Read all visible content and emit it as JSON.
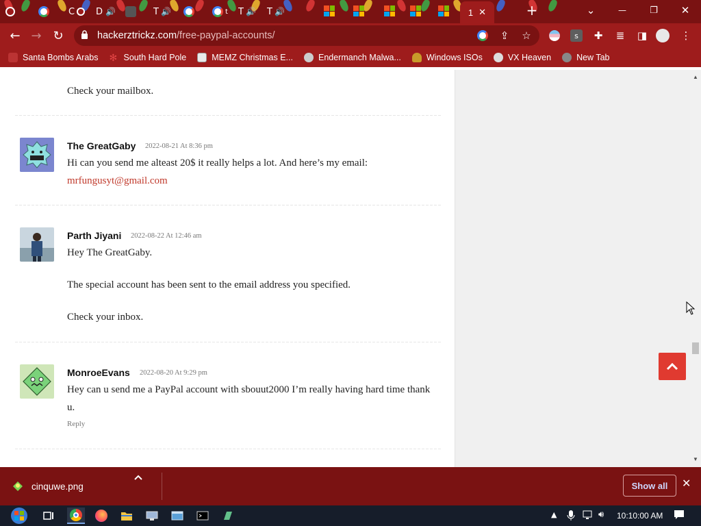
{
  "browser": {
    "tabs": [
      {
        "label": "C",
        "favicon": "google-icon"
      },
      {
        "label": "D",
        "favicon": "dot-icon"
      },
      {
        "label": "T",
        "favicon": "speaker-icon"
      },
      {
        "label": "t",
        "favicon": "google-icon"
      },
      {
        "label": "T",
        "favicon": "speaker-icon"
      },
      {
        "label": "T",
        "favicon": "speaker-icon"
      }
    ],
    "active_tab": {
      "label": "1",
      "close": "✕"
    },
    "new_tab": "+",
    "window_controls": {
      "tab_search": "⌄",
      "minimize": "—",
      "restore": "❐",
      "close": "✕"
    },
    "address": {
      "host": "hackerztrickz.com",
      "path": "/free-paypal-accounts/"
    },
    "bookmarks": [
      {
        "label": "Santa Bombs Arabs",
        "icon": "santa-icon",
        "color": "#b33"
      },
      {
        "label": "South Hard Pole",
        "icon": "snowflake-icon",
        "color": "#c0392b"
      },
      {
        "label": "MEMZ Christmas E...",
        "icon": "page-icon",
        "color": "#ddd"
      },
      {
        "label": "Endermanch Malwa...",
        "icon": "wolf-icon",
        "color": "#999"
      },
      {
        "label": "Windows ISOs",
        "icon": "buddha-icon",
        "color": "#c89b2a"
      },
      {
        "label": "VX Heaven",
        "icon": "vx-icon",
        "color": "#ccc"
      },
      {
        "label": "New Tab",
        "icon": "globe-icon",
        "color": "#777"
      }
    ]
  },
  "page": {
    "comments": [
      {
        "text_lines": [
          "Check your mailbox."
        ]
      },
      {
        "author": "The GreatGaby",
        "date": "2022-08-21 At 8:36 pm",
        "text": "Hi can you send me alteast 20$ it really helps a lot. And here’s my email:",
        "email": "mrfungusyt@gmail.com"
      },
      {
        "author": "Parth Jiyani",
        "date": "2022-08-22 At 12:46 am",
        "p1": "Hey The GreatGaby.",
        "p2": "The special account has been sent to the email address you specified.",
        "p3": "Check your inbox."
      },
      {
        "author": "MonroeEvans",
        "date": "2022-08-20 At 9:29 pm",
        "line1": "Hey can u send me a PayPal account with sbouut2000 I’m really having hard time thank",
        "line2": "u.",
        "reply": "Reply"
      }
    ],
    "back_to_top": "^"
  },
  "downloads": {
    "file": "cinquwe.png",
    "show_all": "Show all",
    "close": "✕"
  },
  "taskbar": {
    "clock": "10:10:00 AM"
  },
  "colors": {
    "frame": "#9e1c1c",
    "frame_dark": "#7a1212",
    "accent_red": "#e03a30",
    "link": "#c0392b"
  }
}
